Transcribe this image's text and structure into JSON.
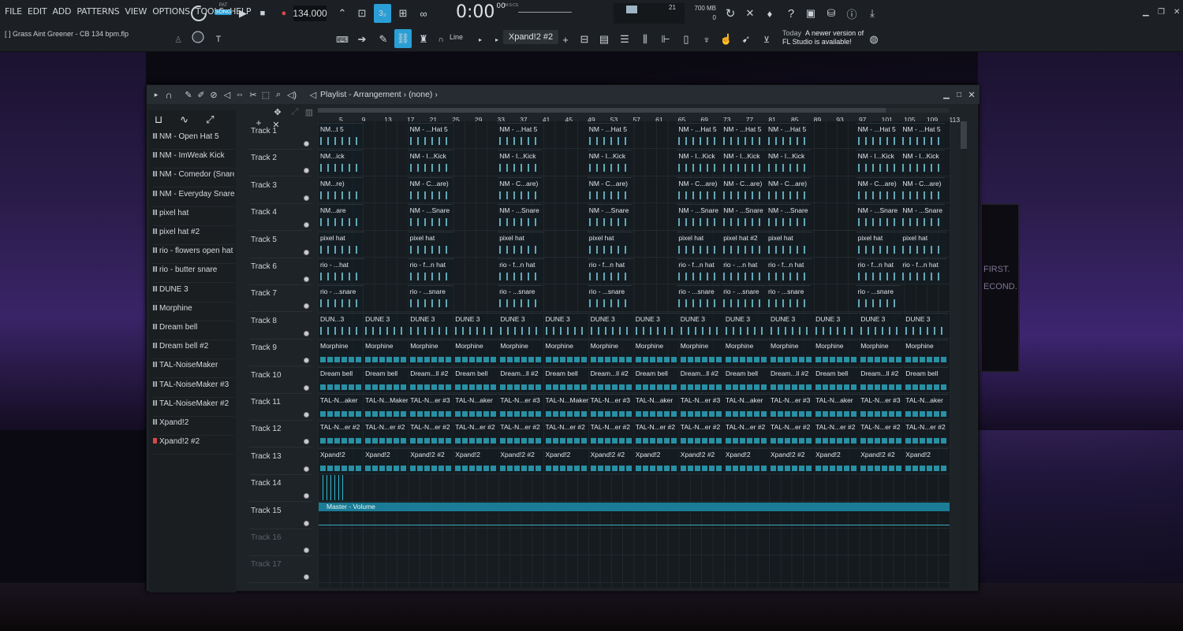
{
  "menu": [
    "FILE",
    "EDIT",
    "ADD",
    "PATTERNS",
    "VIEW",
    "OPTIONS",
    "TOOLS",
    "HELP"
  ],
  "transport": {
    "pat": "PAT",
    "song": "SONG",
    "tempo": "134.000",
    "time": "0:00",
    "time_sub": "00",
    "time_unit": "M:S:CS"
  },
  "memory": {
    "mb": "700 MB",
    "cpu": "21",
    "poly": "0"
  },
  "project_file": "[  ] Grass Aint Greener - CB 134 bpm.flp",
  "snap_label": "Line",
  "pattern_name": "Xpand!2 #2",
  "news": {
    "day": "Today",
    "line1": "A newer version of",
    "line2": "FL Studio is available!"
  },
  "playlist": {
    "title": "Playlist - Arrangement",
    "arrangement": "(none)",
    "ruler": [
      "5",
      "9",
      "13",
      "17",
      "21",
      "25",
      "29",
      "33",
      "37",
      "41",
      "45",
      "49",
      "53",
      "57",
      "61",
      "65",
      "69",
      "73",
      "77",
      "81",
      "85",
      "89",
      "93",
      "97",
      "101",
      "105",
      "109",
      "113"
    ],
    "instruments": [
      "NM - Open Hat 5",
      "NM - ImWeak Kick",
      "NM - Comedor (Snare)",
      "NM - Everyday Snare",
      "pixel hat",
      "pixel hat #2",
      "rio - flowers open hat",
      "rio - butter snare",
      "DUNE 3",
      "Morphine",
      "Dream bell",
      "Dream bell #2",
      "TAL-NoiseMaker",
      "TAL-NoiseMaker #3",
      "TAL-NoiseMaker #2",
      "Xpand!2",
      "Xpand!2 #2"
    ],
    "tracks": [
      "Track 1",
      "Track 2",
      "Track 3",
      "Track 4",
      "Track 5",
      "Track 6",
      "Track 7",
      "Track 8",
      "Track 9",
      "Track 10",
      "Track 11",
      "Track 12",
      "Track 13",
      "Track 14",
      "Track 15",
      "Track 16",
      "Track 17"
    ],
    "automation_label": "Master - Volume"
  },
  "clips": {
    "t1": [
      "NM...t 5",
      "NM - ...Hat 5",
      "NM - ...Hat 5",
      "NM - ...Hat 5",
      "NM - ...Hat 5",
      "NM - ...Hat 5",
      "NM - ...Hat 5",
      "NM - ...Hat 5",
      "NM - ...Hat 5"
    ],
    "t2": [
      "NM...ick",
      "NM - I...Kick",
      "NM - I...Kick",
      "NM - I...Kick",
      "NM - I...Kick",
      "NM - I...Kick",
      "NM - I...Kick",
      "NM - I...Kick",
      "NM - I...Kick"
    ],
    "t3": [
      "NM...re)",
      "NM - C...are)",
      "NM - C...are)",
      "NM - C...are)",
      "NM - C...are)",
      "NM - C...are)",
      "NM - C...are)",
      "NM - C...are)",
      "NM - C...are)"
    ],
    "t4": [
      "NM...are",
      "NM - ...Snare",
      "NM - ...Snare",
      "NM - ...Snare",
      "NM - ...Snare",
      "NM - ...Snare",
      "NM - ...Snare",
      "NM - ...Snare",
      "NM - ...Snare"
    ],
    "t5": [
      "pixel hat",
      "pixel hat",
      "pixel hat",
      "pixel hat",
      "pixel hat",
      "pixel hat #2",
      "pixel hat",
      "pixel hat",
      "pixel hat"
    ],
    "t6": [
      "rio - ...hat",
      "rio - f...n hat",
      "rio - f...n hat",
      "rio - f...n hat",
      "rio - f...n hat",
      "rio - ...n hat",
      "rio - f...n hat",
      "rio - f...n hat",
      "rio - f...n hat"
    ],
    "t7": [
      "rio - ...snare",
      "rio - ...snare",
      "rio - ...snare",
      "rio - ...snare",
      "rio - ...snare",
      "rio - ...snare",
      "rio - ...snare",
      "rio - ...snare"
    ],
    "t8": [
      "DUN...3",
      "DUNE 3",
      "DUNE 3",
      "DUNE 3",
      "DUNE 3",
      "DUNE 3",
      "DUNE 3",
      "DUNE 3",
      "DUNE 3",
      "DUNE 3",
      "DUNE 3",
      "DUNE 3",
      "DUNE 3",
      "DUNE 3"
    ],
    "t9": [
      "Morphine",
      "Morphine",
      "Morphine",
      "Morphine",
      "Morphine",
      "Morphine",
      "Morphine",
      "Morphine",
      "Morphine",
      "Morphine",
      "Morphine",
      "Morphine",
      "Morphine",
      "Morphine"
    ],
    "t10": [
      "Dream bell",
      "Dream bell",
      "Dream...ll #2",
      "Dream bell",
      "Dream...ll #2",
      "Dream bell",
      "Dream...ll #2",
      "Dream bell",
      "Dream...ll #2",
      "Dream bell",
      "Dream...ll #2",
      "Dream bell",
      "Dream...ll #2",
      "Dream bell"
    ],
    "t11": [
      "TAL-N...aker",
      "TAL-N...Maker",
      "TAL-N...er #3",
      "TAL-N...aker",
      "TAL-N...er #3",
      "TAL-N...Maker",
      "TAL-N...er #3",
      "TAL-N...aker",
      "TAL-N...er #3",
      "TAL-N...aker",
      "TAL-N...er #3",
      "TAL-N...aker",
      "TAL-N...er #3",
      "TAL-N...aker"
    ],
    "t12": [
      "TAL-N...er #2",
      "TAL-N...er #2",
      "TAL-N...er #2",
      "TAL-N...er #2",
      "TAL-N...er #2",
      "TAL-N...er #2",
      "TAL-N...er #2",
      "TAL-N...er #2",
      "TAL-N...er #2",
      "TAL-N...er #2",
      "TAL-N...er #2",
      "TAL-N...er #2",
      "TAL-N...er #2",
      "TAL-N...er #2"
    ],
    "t13": [
      "Xpand!2",
      "Xpand!2",
      "Xpand!2 #2",
      "Xpand!2",
      "Xpand!2 #2",
      "Xpand!2",
      "Xpand!2 #2",
      "Xpand!2",
      "Xpand!2 #2",
      "Xpand!2",
      "Xpand!2 #2",
      "Xpand!2",
      "Xpand!2 #2",
      "Xpand!2"
    ]
  },
  "colors": {
    "accent": "#2a9fd6",
    "automation": "#1a7c96",
    "clip_notes": "#7fd6e6"
  }
}
